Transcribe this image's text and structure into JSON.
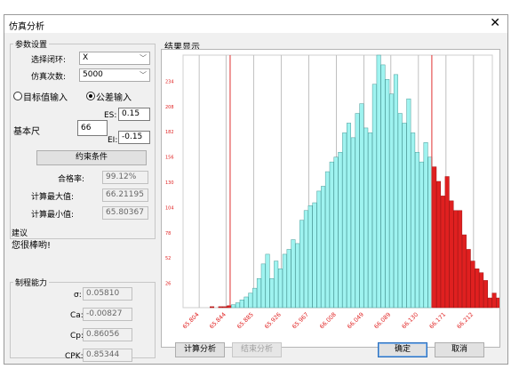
{
  "window": {
    "title": "仿真分析",
    "close_label": "✕"
  },
  "params": {
    "group_title": "参数设置",
    "select_loop_label": "选择闭环:",
    "select_loop_value": "X",
    "sim_count_label": "仿真次数:",
    "sim_count_value": "5000",
    "radio_target": "目标值输入",
    "radio_tolerance": "公差输入",
    "radio_selected": "tolerance",
    "basic_size_label": "基本尺",
    "basic_size_value": "66",
    "es_label": "ES:",
    "es_value": "0.15",
    "ei_label": "EI:",
    "ei_value": "-0.15",
    "constraint_button": "约束条件",
    "pass_rate_label": "合格率:",
    "pass_rate_value": "99.12%",
    "max_label": "计算最大值:",
    "max_value": "66.21195",
    "min_label": "计算最小值:",
    "min_value": "65.80367"
  },
  "advice": {
    "title": "建议",
    "text": "您很棒哟!"
  },
  "capability": {
    "title": "制程能力",
    "sigma_label": "σ:",
    "sigma_value": "0.05810",
    "ca_label": "Ca:",
    "ca_value": "-0.00827",
    "cp_label": "Cp:",
    "cp_value": "0.86056",
    "cpk_label": "CPK:",
    "cpk_value": "0.85344"
  },
  "result": {
    "title": "结果显示"
  },
  "buttons": {
    "calc": "计算分析",
    "stop": "结束分析",
    "ok": "确定",
    "cancel": "取消"
  },
  "chart_data": {
    "type": "bar",
    "title": "",
    "xlabel": "",
    "ylabel": "",
    "ylim": [
      0,
      260
    ],
    "yticks": [
      "26",
      "52",
      "78",
      "104",
      "130",
      "156",
      "182",
      "208",
      "234"
    ],
    "xticks": [
      "65.804",
      "65.844",
      "65.885",
      "65.926",
      "65.967",
      "66.008",
      "66.049",
      "66.089",
      "66.130",
      "66.171",
      "66.212"
    ],
    "xlim": [
      65.78,
      66.24
    ],
    "lower_limit": 65.85,
    "upper_limit": 66.15,
    "bin_width": 0.00636,
    "bin_start": 65.82,
    "in_color": "#9ff3f0",
    "out_color": "#e02020",
    "limit_color": "#e03030",
    "counts": [
      1,
      0,
      1,
      1,
      2,
      3,
      5,
      8,
      11,
      15,
      20,
      30,
      45,
      55,
      30,
      48,
      40,
      55,
      60,
      70,
      66,
      90,
      100,
      105,
      108,
      120,
      125,
      140,
      150,
      155,
      160,
      180,
      190,
      175,
      200,
      210,
      185,
      180,
      230,
      260,
      250,
      235,
      220,
      240,
      200,
      190,
      215,
      180,
      160,
      150,
      170,
      155,
      145,
      130,
      115,
      135,
      110,
      100,
      100,
      75,
      60,
      48,
      40,
      36,
      28,
      10,
      15,
      10,
      8,
      5,
      6,
      4,
      2,
      1,
      2,
      1,
      1
    ]
  }
}
